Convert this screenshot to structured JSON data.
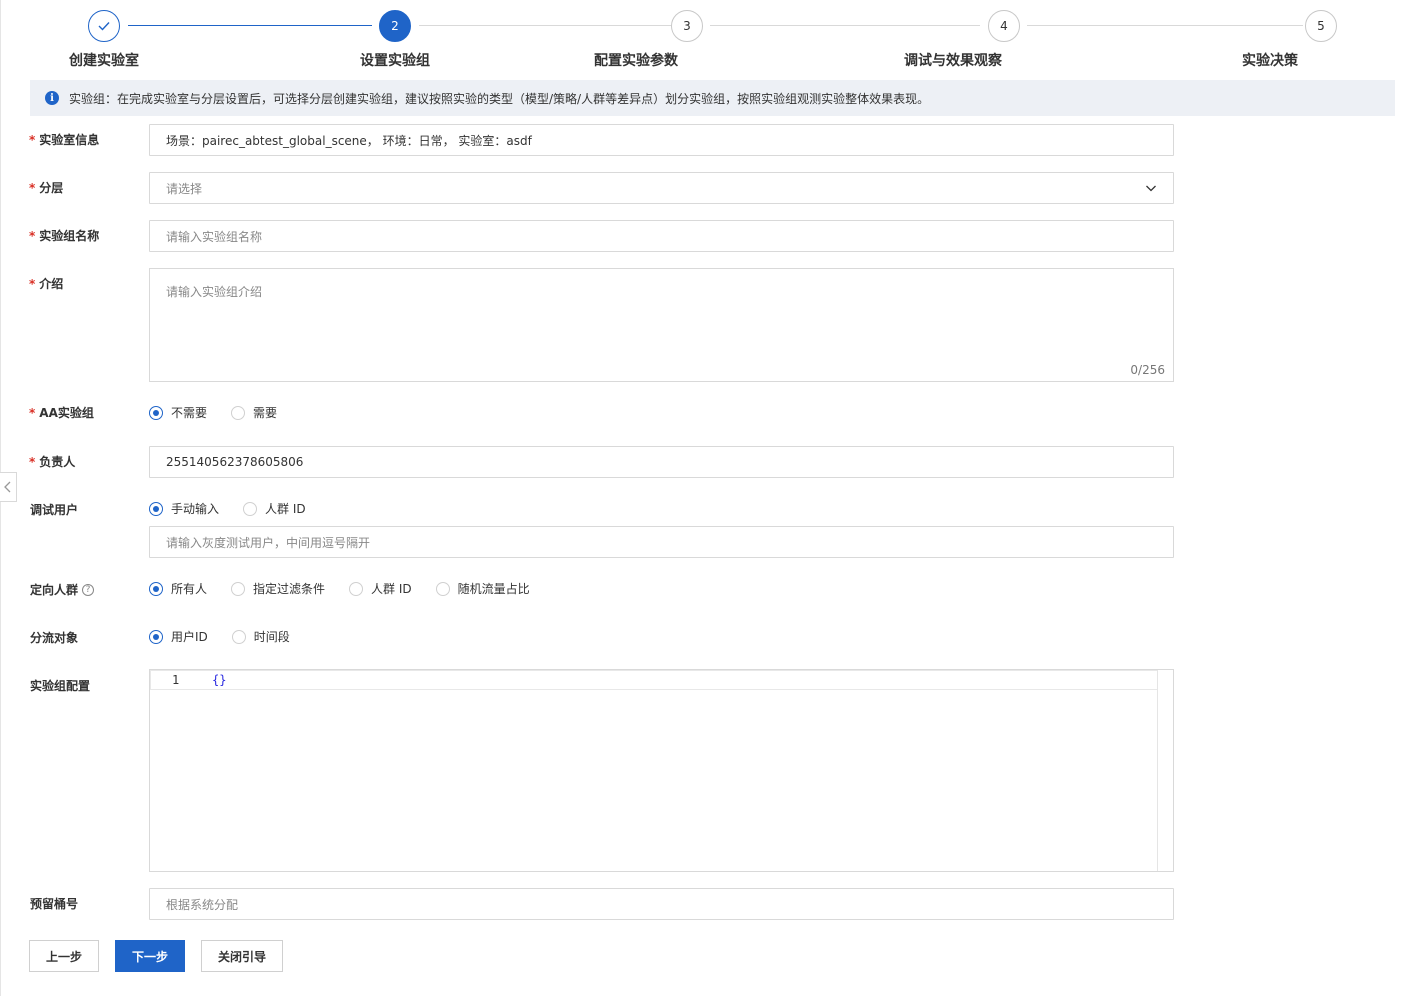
{
  "steps": [
    {
      "number": "",
      "title": "创建实验室",
      "state": "done"
    },
    {
      "number": "2",
      "title": "设置实验组",
      "state": "active"
    },
    {
      "number": "3",
      "title": "配置实验参数",
      "state": "todo"
    },
    {
      "number": "4",
      "title": "调试与效果观察",
      "state": "todo"
    },
    {
      "number": "5",
      "title": "实验决策",
      "state": "todo"
    }
  ],
  "info": {
    "icon": "info-icon",
    "text": "实验组：在完成实验室与分层设置后，可选择分层创建实验组，建议按照实验的类型（模型/策略/人群等差异点）划分实验组，按照实验组观测实验整体效果表现。"
  },
  "form": {
    "lab_info": {
      "label": "实验室信息",
      "value": "场景：pairec_abtest_global_scene， 环境：日常， 实验室：asdf"
    },
    "layer": {
      "label": "分层",
      "placeholder": "请选择"
    },
    "group_name": {
      "label": "实验组名称",
      "placeholder": "请输入实验组名称"
    },
    "intro": {
      "label": "介绍",
      "placeholder": "请输入实验组介绍",
      "counter": "0/256"
    },
    "aa_group": {
      "label": "AA实验组",
      "options": [
        "不需要",
        "需要"
      ],
      "selected": "不需要"
    },
    "owner": {
      "label": "负责人",
      "value": "255140562378605806"
    },
    "debug_users": {
      "label": "调试用户",
      "options": [
        "手动输入",
        "人群 ID"
      ],
      "selected": "手动输入",
      "placeholder": "请输入灰度测试用户，中间用逗号隔开"
    },
    "target_crowd": {
      "label": "定向人群",
      "help_icon": "question-icon",
      "options": [
        "所有人",
        "指定过滤条件",
        "人群 ID",
        "随机流量占比"
      ],
      "selected": "所有人"
    },
    "split_object": {
      "label": "分流对象",
      "options": [
        "用户ID",
        "时间段"
      ],
      "selected": "用户ID"
    },
    "group_config": {
      "label": "实验组配置",
      "line_number": "1",
      "code": "{}"
    },
    "reserved_bucket": {
      "label": "预留桶号",
      "placeholder": "根据系统分配"
    }
  },
  "buttons": {
    "prev": "上一步",
    "next": "下一步",
    "close": "关闭引导"
  },
  "colors": {
    "primary": "#1f64c8",
    "required": "#d93026",
    "info_bg": "#edf0f5"
  }
}
